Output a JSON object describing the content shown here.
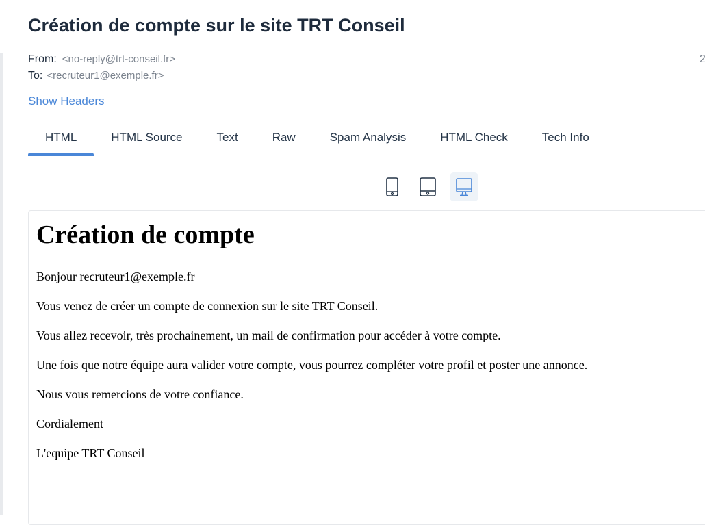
{
  "message": {
    "subject": "Création de compte sur le site TRT Conseil",
    "from_label": "From:",
    "from_value": "<no-reply@trt-conseil.fr>",
    "to_label": "To:",
    "to_value": "<recruteur1@exemple.fr>",
    "date_fragment": "2",
    "show_headers": "Show Headers"
  },
  "tabs": [
    {
      "label": "HTML",
      "active": true
    },
    {
      "label": "HTML Source"
    },
    {
      "label": "Text"
    },
    {
      "label": "Raw"
    },
    {
      "label": "Spam Analysis"
    },
    {
      "label": "HTML Check"
    },
    {
      "label": "Tech Info"
    }
  ],
  "device_toggles": [
    {
      "icon": "mobile-icon"
    },
    {
      "icon": "tablet-icon"
    },
    {
      "icon": "desktop-icon",
      "active": true
    }
  ],
  "colors": {
    "accent": "#4a87d8",
    "title": "#1e2b3c",
    "muted": "#7b838e"
  },
  "email_body": {
    "heading": "Création de compte",
    "paragraphs": [
      "Bonjour recruteur1@exemple.fr",
      "Vous venez de créer un compte de connexion sur le site TRT Conseil.",
      "Vous allez recevoir, très prochainement, un mail de confirmation pour accéder à votre compte.",
      "Une fois que notre équipe aura valider votre compte, vous pourrez compléter votre profil et poster une annonce.",
      "Nous vous remercions de votre confiance.",
      "Cordialement",
      "L'equipe TRT Conseil"
    ]
  }
}
